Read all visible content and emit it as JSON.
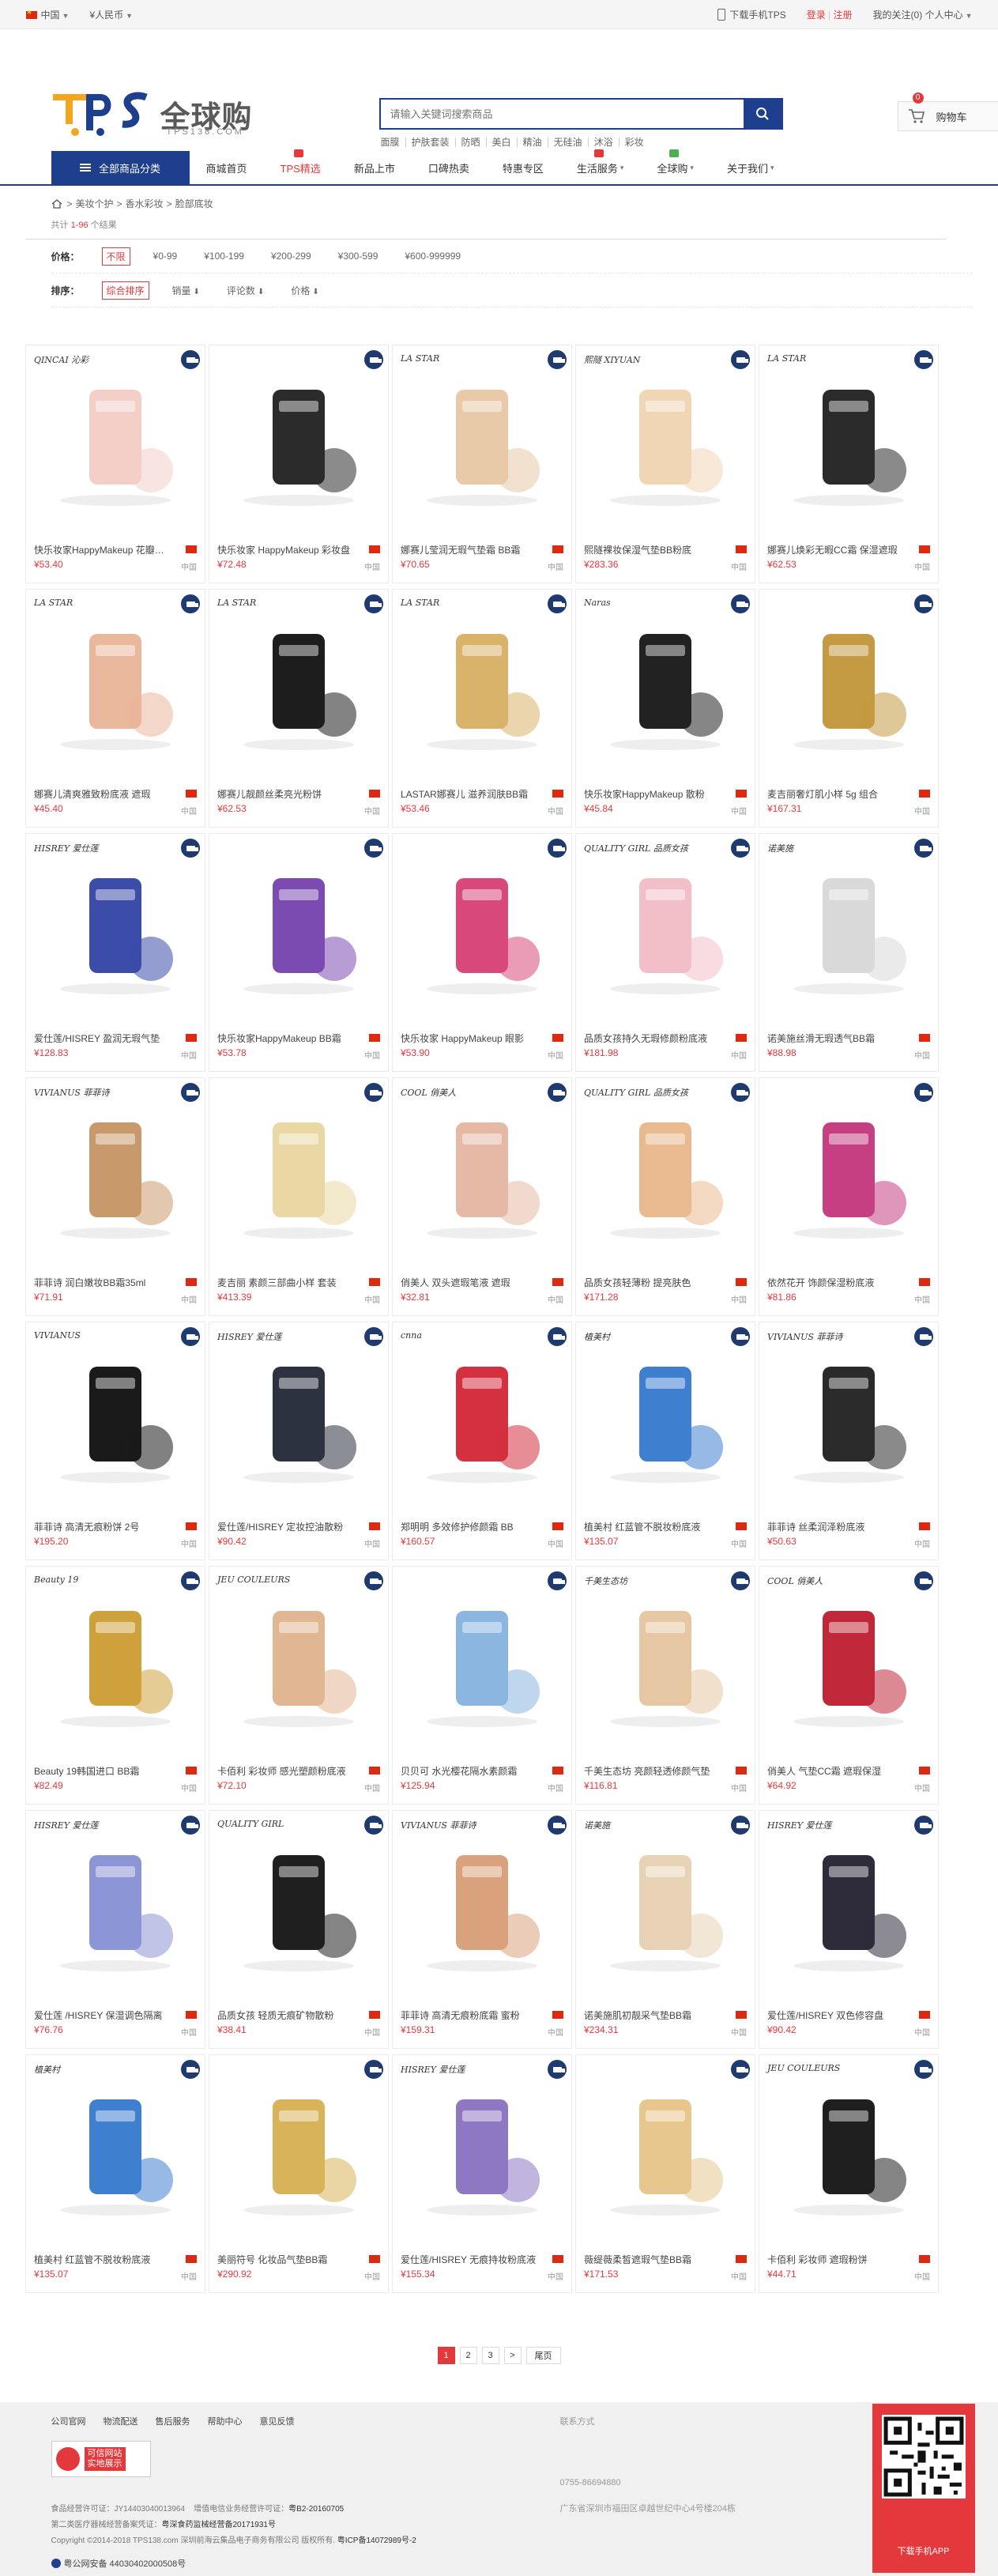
{
  "topbar": {
    "country": "中国",
    "currency": "¥人民币",
    "download_app": "下载手机TPS",
    "login": "登录",
    "register": "注册",
    "my_follow": "我的关注(0)",
    "personal_center": "个人中心"
  },
  "header": {
    "logo_en": "TPS",
    "logo_cn": "全球购",
    "logo_domain": "TPS138.COM",
    "search_placeholder": "请输入关键词搜索商品",
    "hot_words": [
      "面膜",
      "护肤套装",
      "防晒",
      "美白",
      "精油",
      "无硅油",
      "沐浴",
      "彩妆"
    ],
    "cart_label": "购物车",
    "cart_count": "0"
  },
  "nav": {
    "all_categories": "全部商品分类",
    "items": [
      {
        "label": "商城首页",
        "caret": "",
        "tag": ""
      },
      {
        "label": "TPS精选",
        "caret": "",
        "tag": "r"
      },
      {
        "label": "新品上市",
        "caret": "",
        "tag": ""
      },
      {
        "label": "口碑热卖",
        "caret": "",
        "tag": ""
      },
      {
        "label": "特惠专区",
        "caret": "",
        "tag": ""
      },
      {
        "label": "生活服务",
        "caret": "▾",
        "tag": "r"
      },
      {
        "label": "全球购",
        "caret": "▾",
        "tag": "g"
      },
      {
        "label": "关于我们",
        "caret": "▾",
        "tag": ""
      }
    ]
  },
  "breadcrumb": [
    "美妆个护",
    "香水彩妆",
    "脸部底妆"
  ],
  "result_count": {
    "prefix": "共计",
    "range": "1-96",
    "suffix": "个结果"
  },
  "filters": {
    "price_label": "价格：",
    "price_options": [
      "不限",
      "¥0-99",
      "¥100-199",
      "¥200-299",
      "¥300-599",
      "¥600-999999"
    ],
    "sort_label": "排序：",
    "sort_options": [
      {
        "label": "综合排序",
        "arrow": ""
      },
      {
        "label": "销量",
        "arrow": "⬇"
      },
      {
        "label": "评论数",
        "arrow": "⬇"
      },
      {
        "label": "价格",
        "arrow": "⬇"
      }
    ]
  },
  "products": [
    {
      "name": "快乐妆家HappyMakeup 花瓣腮红",
      "price": "¥53.40",
      "origin": "中国",
      "brand": "QINCAI 沁彩",
      "color": "#f3cfc8"
    },
    {
      "name": "快乐妆家 HappyMakeup 彩妆盘",
      "price": "¥72.48",
      "origin": "中国",
      "brand": "",
      "color": "#2b2b2b"
    },
    {
      "name": "娜赛儿莹润无瑕气垫霜 BB霜",
      "price": "¥70.65",
      "origin": "中国",
      "brand": "LA STAR",
      "color": "#e8c9a8"
    },
    {
      "name": "熙隧裸妆保湿气垫BB粉底",
      "price": "¥283.36",
      "origin": "中国",
      "brand": "熙隧 XIYUAN",
      "color": "#f1d6b6"
    },
    {
      "name": "娜赛儿焕彩无暇CC霜 保湿遮瑕",
      "price": "¥62.53",
      "origin": "中国",
      "brand": "LA STAR",
      "color": "#2a2a2a"
    },
    {
      "name": "娜赛儿清爽雅致粉底液 遮瑕",
      "price": "¥45.40",
      "origin": "中国",
      "brand": "LA STAR",
      "color": "#e9b79b"
    },
    {
      "name": "娜赛儿靓颜丝柔亮光粉饼",
      "price": "¥62.53",
      "origin": "中国",
      "brand": "LA STAR",
      "color": "#1d1d1d"
    },
    {
      "name": "LASTAR娜赛儿 滋养润肤BB霜",
      "price": "¥53.46",
      "origin": "中国",
      "brand": "LA STAR",
      "color": "#d9b36a"
    },
    {
      "name": "快乐妆家HappyMakeup 散粉",
      "price": "¥45.84",
      "origin": "中国",
      "brand": "Naras",
      "color": "#222222"
    },
    {
      "name": "麦吉丽奢灯肌小样 5g 组合",
      "price": "¥167.31",
      "origin": "中国",
      "brand": "",
      "color": "#c49a42"
    },
    {
      "name": "爱仕莲/HISREY 盈润无瑕气垫",
      "price": "¥128.83",
      "origin": "中国",
      "brand": "HISREY 爱仕莲",
      "color": "#3b4da8"
    },
    {
      "name": "快乐妆家HappyMakeup BB霜",
      "price": "¥53.78",
      "origin": "中国",
      "brand": "",
      "color": "#7b4bb2"
    },
    {
      "name": "快乐妆家 HappyMakeup 眼影",
      "price": "¥53.90",
      "origin": "中国",
      "brand": "",
      "color": "#d8487a"
    },
    {
      "name": "品质女孩持久无瑕修颜粉底液",
      "price": "¥181.98",
      "origin": "中国",
      "brand": "QUALITY GIRL 品质女孩",
      "color": "#f2bfc8"
    },
    {
      "name": "诺美施丝滑无瑕透气BB霜",
      "price": "¥88.98",
      "origin": "中国",
      "brand": "诺美施",
      "color": "#d9d9d9"
    },
    {
      "name": "菲菲诗 润白嫩妆BB霜35ml",
      "price": "¥71.91",
      "origin": "中国",
      "brand": "VIVIANUS 菲菲诗",
      "color": "#c89a6b"
    },
    {
      "name": "麦吉丽 素颜三部曲小样 套装",
      "price": "¥413.39",
      "origin": "中国",
      "brand": "",
      "color": "#e9d7a4"
    },
    {
      "name": "俏美人 双头遮瑕笔液 遮瑕",
      "price": "¥32.81",
      "origin": "中国",
      "brand": "COOL 俏美人",
      "color": "#e5b9a6"
    },
    {
      "name": "品质女孩轻薄粉 提亮肤色",
      "price": "¥171.28",
      "origin": "中国",
      "brand": "QUALITY GIRL 品质女孩",
      "color": "#e9b98f"
    },
    {
      "name": "依然花开 饰颜保湿粉底液",
      "price": "¥81.86",
      "origin": "中国",
      "brand": "",
      "color": "#c63f83"
    },
    {
      "name": "菲菲诗 高清无痕粉饼 2号",
      "price": "¥195.20",
      "origin": "中国",
      "brand": "VIVIANUS",
      "color": "#1a1a1a"
    },
    {
      "name": "爱仕莲/HISREY 定妆控油散粉",
      "price": "¥90.42",
      "origin": "中国",
      "brand": "HISREY 爱仕莲",
      "color": "#2d3240"
    },
    {
      "name": "郑明明 多效修护修颜霜 BB",
      "price": "¥160.57",
      "origin": "中国",
      "brand": "cnna",
      "color": "#d4303f"
    },
    {
      "name": "植美村 红蓝管不脱妆粉底液",
      "price": "¥135.07",
      "origin": "中国",
      "brand": "植美村",
      "color": "#3f7fd0"
    },
    {
      "name": "菲菲诗 丝柔润泽粉底液",
      "price": "¥50.63",
      "origin": "中国",
      "brand": "VIVIANUS 菲菲诗",
      "color": "#2a2a2a"
    },
    {
      "name": "Beauty 19韩国进口 BB霜",
      "price": "¥82.49",
      "origin": "中国",
      "brand": "Beauty 19",
      "color": "#cfa13d"
    },
    {
      "name": "卡佰利 彩妆师 感光塑颜粉底液",
      "price": "¥72.10",
      "origin": "中国",
      "brand": "JEU COULEURS",
      "color": "#e1b692"
    },
    {
      "name": "贝贝可 水光樱花隔水素颜霜",
      "price": "¥125.94",
      "origin": "中国",
      "brand": "",
      "color": "#8bb6e0"
    },
    {
      "name": "千美生态坊 亮颜轻透修颜气垫",
      "price": "¥116.81",
      "origin": "中国",
      "brand": "千美生态坊",
      "color": "#e5c7a3"
    },
    {
      "name": "俏美人 气垫CC霜 遮瑕保湿",
      "price": "¥64.92",
      "origin": "中国",
      "brand": "COOL 俏美人",
      "color": "#c0283a"
    },
    {
      "name": "爱仕莲 /HISREY 保湿调色隔离",
      "price": "¥76.76",
      "origin": "中国",
      "brand": "HISREY 爱仕莲",
      "color": "#8c96d6"
    },
    {
      "name": "品质女孩 轻质无痕矿物散粉",
      "price": "¥38.41",
      "origin": "中国",
      "brand": "QUALITY GIRL",
      "color": "#1f1f1f"
    },
    {
      "name": "菲菲诗 高清无痕粉底霜 蜜粉",
      "price": "¥159.31",
      "origin": "中国",
      "brand": "VIVIANUS 菲菲诗",
      "color": "#d9a27d"
    },
    {
      "name": "诺美施肌初靓采气垫BB霜",
      "price": "¥234.31",
      "origin": "中国",
      "brand": "诺美施",
      "color": "#e8d2b5"
    },
    {
      "name": "爱仕莲/HISREY 双色修容盘",
      "price": "¥90.42",
      "origin": "中国",
      "brand": "HISREY 爱仕莲",
      "color": "#2e2b3a"
    },
    {
      "name": "植美村 红蓝管不脱妆粉底液",
      "price": "¥135.07",
      "origin": "中国",
      "brand": "植美村",
      "color": "#3f7fd0"
    },
    {
      "name": "美丽符号 化妆品气垫BB霜",
      "price": "¥290.92",
      "origin": "中国",
      "brand": "",
      "color": "#d9b35a"
    },
    {
      "name": "爱仕莲/HISREY 无痕持妆粉底液",
      "price": "¥155.34",
      "origin": "中国",
      "brand": "HISREY 爱仕莲",
      "color": "#8e78c4"
    },
    {
      "name": "薇缇薇柔皙遮瑕气垫BB霜",
      "price": "¥171.53",
      "origin": "中国",
      "brand": "",
      "color": "#e8c78f"
    },
    {
      "name": "卡佰利 彩妆师 遮瑕粉饼",
      "price": "¥44.71",
      "origin": "中国",
      "brand": "JEU COULEURS",
      "color": "#1f1f1f"
    }
  ],
  "pagination": {
    "pages": [
      "1",
      "2",
      "3"
    ],
    "next": ">",
    "last": "尾页"
  },
  "footer": {
    "links": [
      "公司官网",
      "物流配送",
      "售后服务",
      "帮助中心",
      "意见反馈"
    ],
    "badge_text_1": "可信网站",
    "badge_text_2": "实地展示",
    "license_1_label": "食品经营许可证：JY14403040013964",
    "license_1b_label": "增值电信业务经营许可证：",
    "license_1b_value": "粤B2-20160705",
    "license_2_label": "第二类医疗器械经营备案凭证：",
    "license_2_value": "粤深食药监械经营备20171931号",
    "copyright": "Copyright ©2014-2018 TPS138.com 深圳前海云集品电子商务有限公司 版权所有.",
    "icp": "粤ICP备14072989号-2",
    "police": "粤公网安备 44030402000508号",
    "contact_title": "联系方式",
    "contact_phone": "0755-86694880",
    "contact_address": "广东省深圳市福田区卓越世纪中心4号楼204栋",
    "qr_caption": "下载手机APP"
  }
}
